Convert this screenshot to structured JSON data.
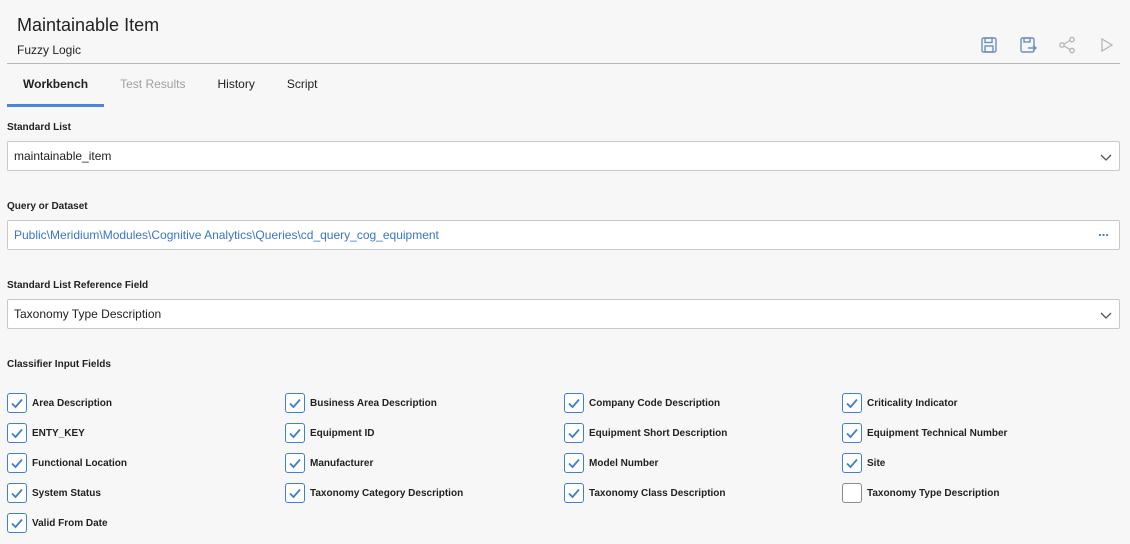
{
  "header": {
    "title": "Maintainable Item",
    "subtitle": "Fuzzy Logic",
    "toolbar_icons": [
      "save-icon",
      "save-as-icon",
      "share-icon",
      "run-icon"
    ]
  },
  "tabs": [
    {
      "label": "Workbench",
      "state": "active"
    },
    {
      "label": "Test Results",
      "state": "disabled"
    },
    {
      "label": "History",
      "state": "normal"
    },
    {
      "label": "Script",
      "state": "normal"
    }
  ],
  "standard_list": {
    "label": "Standard List",
    "value": "maintainable_item"
  },
  "query": {
    "label": "Query or Dataset",
    "value": "Public\\Meridium\\Modules\\Cognitive Analytics\\Queries\\cd_query_cog_equipment",
    "more": "..."
  },
  "reference_field": {
    "label": "Standard List Reference Field",
    "value": "Taxonomy Type Description"
  },
  "classifier": {
    "label": "Classifier Input Fields",
    "fields": [
      {
        "label": "Area Description",
        "checked": true
      },
      {
        "label": "Business Area Description",
        "checked": true
      },
      {
        "label": "Company Code Description",
        "checked": true
      },
      {
        "label": "Criticality Indicator",
        "checked": true
      },
      {
        "label": "ENTY_KEY",
        "checked": true
      },
      {
        "label": "Equipment ID",
        "checked": true
      },
      {
        "label": "Equipment Short Description",
        "checked": true
      },
      {
        "label": "Equipment Technical Number",
        "checked": true
      },
      {
        "label": "Functional Location",
        "checked": true
      },
      {
        "label": "Manufacturer",
        "checked": true
      },
      {
        "label": "Model Number",
        "checked": true
      },
      {
        "label": "Site",
        "checked": true
      },
      {
        "label": "System Status",
        "checked": true
      },
      {
        "label": "Taxonomy Category Description",
        "checked": true
      },
      {
        "label": "Taxonomy Class Description",
        "checked": true
      },
      {
        "label": "Taxonomy Type Description",
        "checked": false
      },
      {
        "label": "Valid From Date",
        "checked": true
      }
    ]
  },
  "colors": {
    "accent": "#4c86d6",
    "link": "#3b74c9",
    "icon": "#6d8fc2"
  }
}
